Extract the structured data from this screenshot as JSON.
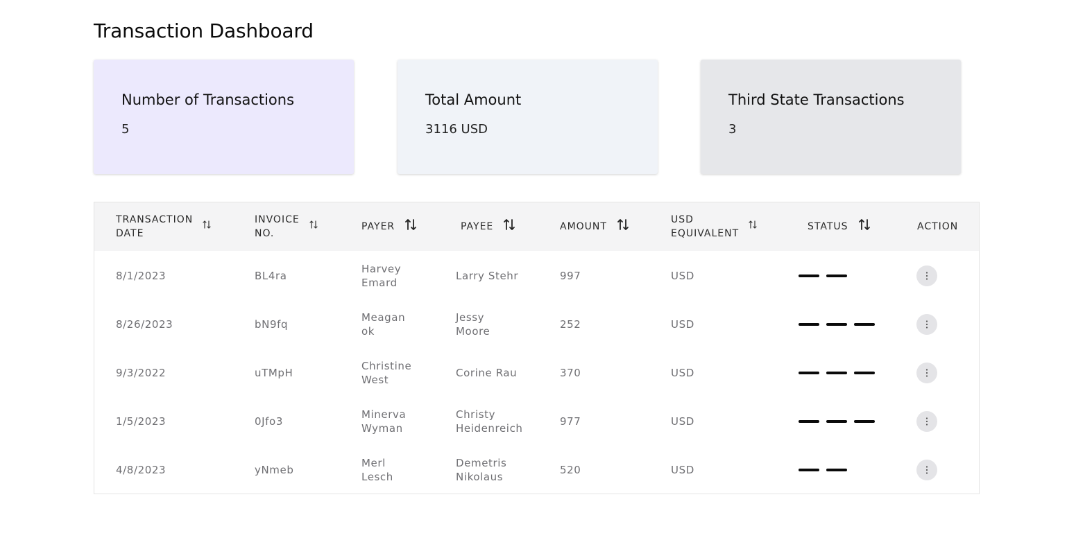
{
  "page": {
    "title": "Transaction Dashboard"
  },
  "cards": [
    {
      "title": "Number of Transactions",
      "value": "5",
      "color": "#ece9fd"
    },
    {
      "title": "Total Amount",
      "value": "3116 USD",
      "color": "#f0f3f8"
    },
    {
      "title": "Third State Transactions",
      "value": "3",
      "color": "#e6e7ea"
    }
  ],
  "table": {
    "headers": [
      {
        "label": "TRANSACTION\nDATE",
        "sort_icon": "sort-arrows-icon"
      },
      {
        "label": "INVOICE\nNO.",
        "sort_icon": "sort-arrows-icon"
      },
      {
        "label": "PAYER",
        "sort_icon": "sort-arrows-icon"
      },
      {
        "label": "PAYEE",
        "sort_icon": "sort-arrows-icon"
      },
      {
        "label": "AMOUNT",
        "sort_icon": "sort-arrows-icon"
      },
      {
        "label": "USD\nEQUIVALENT",
        "sort_icon": "sort-arrows-icon"
      },
      {
        "label": "STATUS",
        "sort_icon": "sort-arrows-icon"
      },
      {
        "label": "ACTION"
      }
    ],
    "rows": [
      {
        "date": "8/1/2023",
        "invoice": "BL4ra",
        "payer": "Harvey\nEmard",
        "payee": "Larry Stehr",
        "amount": "997",
        "usd": "USD",
        "status_level": 2
      },
      {
        "date": "8/26/2023",
        "invoice": "bN9fq",
        "payer": "Meagan\nok",
        "payee": "Jessy\nMoore",
        "amount": "252",
        "usd": "USD",
        "status_level": 3
      },
      {
        "date": "9/3/2022",
        "invoice": "uTMpH",
        "payer": "Christine\nWest",
        "payee": "Corine Rau",
        "amount": "370",
        "usd": "USD",
        "status_level": 3
      },
      {
        "date": "1/5/2023",
        "invoice": "0Jfo3",
        "payer": "Minerva\nWyman",
        "payee": "Christy\nHeidenreich",
        "amount": "977",
        "usd": "USD",
        "status_level": 3
      },
      {
        "date": "4/8/2023",
        "invoice": "yNmeb",
        "payer": "Merl\nLesch",
        "payee": "Demetris\nNikolaus",
        "amount": "520",
        "usd": "USD",
        "status_level": 2
      }
    ],
    "action_icon": "more-vertical-icon"
  }
}
